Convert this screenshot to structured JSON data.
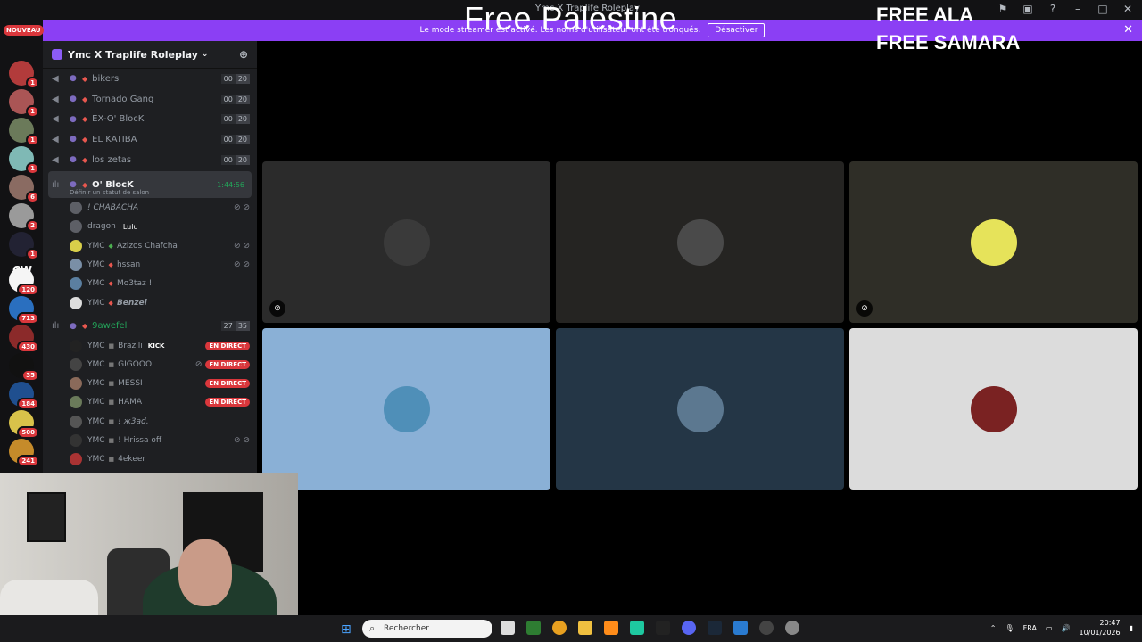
{
  "window": {
    "title": "Ymc X Traplife Roleplay"
  },
  "overlay": {
    "line1": "Free Palestine",
    "line2": "FREE ALA",
    "line3": "FREE SAMARA"
  },
  "banner": {
    "message": "Le mode streamer est activé. Les noms d'utilisateur ont été tronqués.",
    "button": "Désactiver"
  },
  "server_list": {
    "new_label": "NOUVEAU",
    "cw_label": "CW",
    "badges": [
      "1",
      "1",
      "1",
      "1",
      "6",
      "2",
      "1",
      "120",
      "713",
      "430",
      "35",
      "184",
      "500",
      "241"
    ]
  },
  "server": {
    "name": "Ymc X Traplife Roleplay"
  },
  "channels": [
    {
      "name": "bikers",
      "a": "00",
      "b": "20"
    },
    {
      "name": "Tornado Gang",
      "a": "00",
      "b": "20"
    },
    {
      "name": "EX-O' BlocK",
      "a": "00",
      "b": "20"
    },
    {
      "name": "EL KATIBA",
      "a": "00",
      "b": "20"
    },
    {
      "name": "los zetas",
      "a": "00",
      "b": "20"
    }
  ],
  "active_channel": {
    "name": "O' BlocK",
    "timer": "1:44:56",
    "status": "Définir un statut de salon"
  },
  "members_oblock": [
    {
      "tag": "",
      "name": "! CHABACHA"
    },
    {
      "tag": "",
      "name": "dragon",
      "extra": "Lulu"
    },
    {
      "tag": "YMC",
      "name": "Azizos Chafcha"
    },
    {
      "tag": "YMC",
      "name": "hssan"
    },
    {
      "tag": "YMC",
      "name": "Mo3taz !"
    },
    {
      "tag": "YMC",
      "name": "Benzel"
    }
  ],
  "channel2": {
    "name": "9awefel",
    "a": "27",
    "b": "35"
  },
  "members_9awefel": [
    {
      "tag": "YMC",
      "name": "Brazili",
      "extra": "KICK",
      "live": "EN DIRECT"
    },
    {
      "tag": "YMC",
      "name": "GIGOOO",
      "live": "EN DIRECT"
    },
    {
      "tag": "YMC",
      "name": "MESSI",
      "live": "EN DIRECT"
    },
    {
      "tag": "YMC",
      "name": "HAMA",
      "live": "EN DIRECT"
    },
    {
      "tag": "YMC",
      "name": "! ж3ad."
    },
    {
      "tag": "YMC",
      "name": "! Hrissa off"
    },
    {
      "tag": "YMC",
      "name": "4ekeer"
    }
  ],
  "tiles": [
    {
      "bg": "#2b2b2b",
      "avatar": "#3a3a3a",
      "muted": true
    },
    {
      "bg": "#252422",
      "avatar": "#4a4a4a",
      "muted": false
    },
    {
      "bg": "#2f2e27",
      "avatar": "#e6e35a",
      "muted": true
    },
    {
      "bg": "#8ab0d6",
      "avatar": "#4f8fb8",
      "muted": false
    },
    {
      "bg": "#243646",
      "avatar": "#5c7890",
      "muted": false
    },
    {
      "bg": "#dcdcdc",
      "avatar": "#7a2222",
      "muted": false
    }
  ],
  "taskbar": {
    "search_placeholder": "Rechercher",
    "lang": "FRA",
    "time": "20:47",
    "date": "10/01/2026"
  }
}
